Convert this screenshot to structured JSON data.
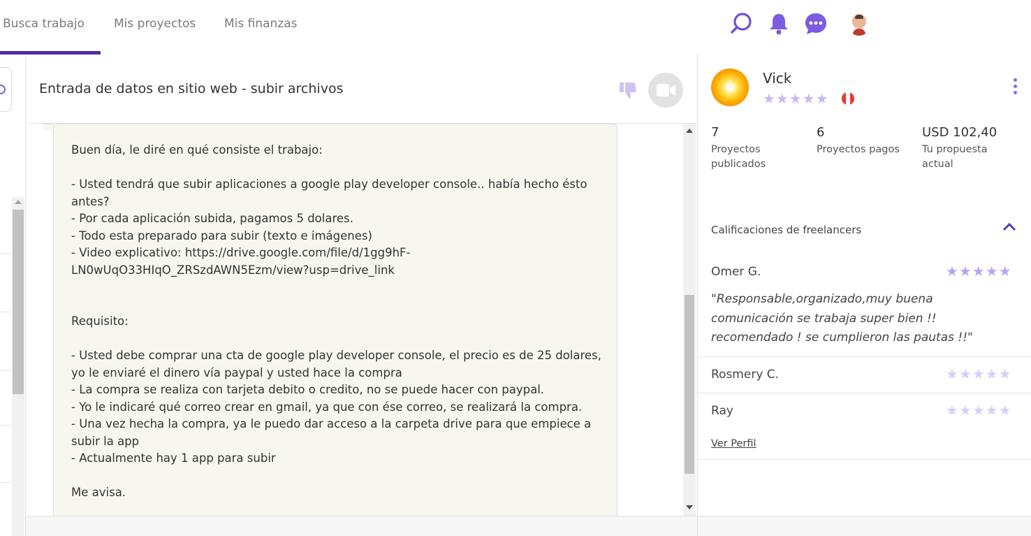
{
  "nav": {
    "tabs": [
      {
        "label": "Busca trabajo"
      },
      {
        "label": "Mis proyectos"
      },
      {
        "label": "Mis finanzas"
      }
    ],
    "icons": [
      "search-icon",
      "bell-icon",
      "chat-icon",
      "user-avatar"
    ],
    "accent": "#7c5ce0",
    "active_underline": "#4f2d9e"
  },
  "project": {
    "title": "Entrada de datos en sitio web - subir archivos",
    "message": "Buen día, le diré en qué consiste el trabajo:\n\n- Usted tendrá que subir aplicaciones a google play developer console.. había hecho ésto antes?\n- Por cada aplicación subida, pagamos 5 dolares.\n- Todo esta preparado para subir (texto e imágenes)\n- Video explicativo: https://drive.google.com/file/d/1gg9hF-LN0wUqO33HIqO_ZRSzdAWN5Ezm/view?usp=drive_link\n\n\nRequisito:\n\n- Usted debe comprar una cta de google play developer console, el precio es de 25 dolares, yo le enviaré el dinero vía paypal y usted hace la compra\n- La compra se realiza con tarjeta debito o credito, no se puede hacer con paypal.\n- Yo le indicaré qué correo crear en gmail, ya que con ése correo, se realizará la compra.\n- Una vez hecha la compra, ya le puedo dar acceso a la carpeta drive para que empiece a subir la app\n- Actualmente hay 1 app para subir\n\nMe avisa."
  },
  "client": {
    "name": "Vick",
    "stars": "★★★★★",
    "rating_of_5": 0,
    "country_flag": "peru-flag",
    "stats": [
      {
        "value": "7",
        "label": "Proyectos publicados"
      },
      {
        "value": "6",
        "label": "Proyectos pagos"
      },
      {
        "value": "USD 102,40",
        "label": "Tu propuesta actual"
      }
    ]
  },
  "ratings": {
    "title": "Calificaciones de freelancers",
    "reviews": [
      {
        "name": "Omer G.",
        "stars": "★★★★★",
        "rating_of_5": 5,
        "text": "\"Responsable,organizado,muy buena comunicación se trabaja super bien !! recomendado ! se cumplieron las pautas !!\""
      },
      {
        "name": "Rosmery C.",
        "stars": "★★★★★",
        "rating_of_5": 0
      },
      {
        "name": "Ray",
        "stars": "★★★★★",
        "rating_of_5": 0
      }
    ],
    "profile_link": "Ver Perfil",
    "star_filled_color": "#b9a3ef",
    "star_empty_color": "#d9cef6"
  }
}
